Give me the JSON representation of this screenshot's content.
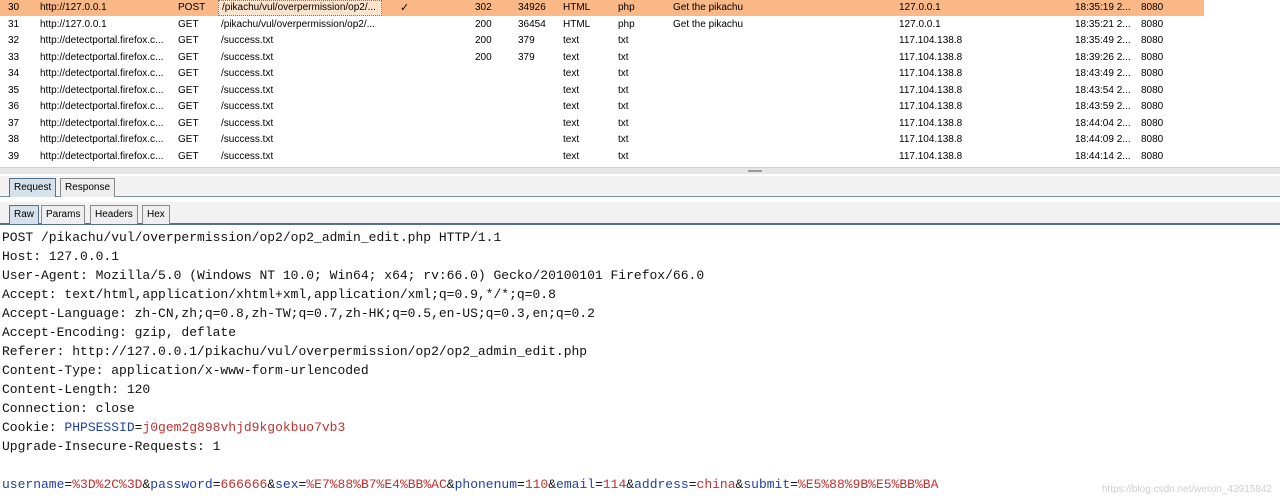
{
  "history": {
    "rows": [
      {
        "num": "30",
        "host": "http://127.0.0.1",
        "method": "POST",
        "url": "/pikachu/vul/overpermission/op2/...",
        "tick": "✓",
        "status": "302",
        "length": "34926",
        "mime": "HTML",
        "ext": "php",
        "title": "Get the pikachu",
        "ip": "127.0.0.1",
        "time": "18:35:19 2...",
        "port": "8080",
        "selected": true
      },
      {
        "num": "31",
        "host": "http://127.0.0.1",
        "method": "GET",
        "url": "/pikachu/vul/overpermission/op2/...",
        "tick": "",
        "status": "200",
        "length": "36454",
        "mime": "HTML",
        "ext": "php",
        "title": "Get the pikachu",
        "ip": "127.0.0.1",
        "time": "18:35:21 2...",
        "port": "8080"
      },
      {
        "num": "32",
        "host": "http://detectportal.firefox.c...",
        "method": "GET",
        "url": "/success.txt",
        "tick": "",
        "status": "200",
        "length": "379",
        "mime": "text",
        "ext": "txt",
        "title": "",
        "ip": "117.104.138.8",
        "time": "18:35:49 2...",
        "port": "8080"
      },
      {
        "num": "33",
        "host": "http://detectportal.firefox.c...",
        "method": "GET",
        "url": "/success.txt",
        "tick": "",
        "status": "200",
        "length": "379",
        "mime": "text",
        "ext": "txt",
        "title": "",
        "ip": "117.104.138.8",
        "time": "18:39:26 2...",
        "port": "8080"
      },
      {
        "num": "34",
        "host": "http://detectportal.firefox.c...",
        "method": "GET",
        "url": "/success.txt",
        "tick": "",
        "status": "",
        "length": "",
        "mime": "text",
        "ext": "txt",
        "title": "",
        "ip": "117.104.138.8",
        "time": "18:43:49 2...",
        "port": "8080"
      },
      {
        "num": "35",
        "host": "http://detectportal.firefox.c...",
        "method": "GET",
        "url": "/success.txt",
        "tick": "",
        "status": "",
        "length": "",
        "mime": "text",
        "ext": "txt",
        "title": "",
        "ip": "117.104.138.8",
        "time": "18:43:54 2...",
        "port": "8080"
      },
      {
        "num": "36",
        "host": "http://detectportal.firefox.c...",
        "method": "GET",
        "url": "/success.txt",
        "tick": "",
        "status": "",
        "length": "",
        "mime": "text",
        "ext": "txt",
        "title": "",
        "ip": "117.104.138.8",
        "time": "18:43:59 2...",
        "port": "8080"
      },
      {
        "num": "37",
        "host": "http://detectportal.firefox.c...",
        "method": "GET",
        "url": "/success.txt",
        "tick": "",
        "status": "",
        "length": "",
        "mime": "text",
        "ext": "txt",
        "title": "",
        "ip": "117.104.138.8",
        "time": "18:44:04 2...",
        "port": "8080"
      },
      {
        "num": "38",
        "host": "http://detectportal.firefox.c...",
        "method": "GET",
        "url": "/success.txt",
        "tick": "",
        "status": "",
        "length": "",
        "mime": "text",
        "ext": "txt",
        "title": "",
        "ip": "117.104.138.8",
        "time": "18:44:09 2...",
        "port": "8080"
      },
      {
        "num": "39",
        "host": "http://detectportal.firefox.c...",
        "method": "GET",
        "url": "/success.txt",
        "tick": "",
        "status": "",
        "length": "",
        "mime": "text",
        "ext": "txt",
        "title": "",
        "ip": "117.104.138.8",
        "time": "18:44:14 2...",
        "port": "8080"
      }
    ]
  },
  "message_tabs": {
    "request": "Request",
    "response": "Response",
    "active": "request"
  },
  "view_tabs": {
    "raw": "Raw",
    "params": "Params",
    "headers": "Headers",
    "hex": "Hex",
    "active": "raw"
  },
  "request": {
    "request_line": "POST /pikachu/vul/overpermission/op2/op2_admin_edit.php HTTP/1.1",
    "headers": [
      "Host: 127.0.0.1",
      "User-Agent: Mozilla/5.0 (Windows NT 10.0; Win64; x64; rv:66.0) Gecko/20100101 Firefox/66.0",
      "Accept: text/html,application/xhtml+xml,application/xml;q=0.9,*/*;q=0.8",
      "Accept-Language: zh-CN,zh;q=0.8,zh-TW;q=0.7,zh-HK;q=0.5,en-US;q=0.3,en;q=0.2",
      "Accept-Encoding: gzip, deflate",
      "Referer: http://127.0.0.1/pikachu/vul/overpermission/op2/op2_admin_edit.php",
      "Content-Type: application/x-www-form-urlencoded",
      "Content-Length: 120",
      "Connection: close"
    ],
    "cookie": {
      "label": "Cookie: ",
      "name": "PHPSESSID",
      "value": "j0gem2g898vhjd9kgokbuo7vb3"
    },
    "after_cookie": [
      "Upgrade-Insecure-Requests: 1"
    ],
    "body_params": [
      {
        "name": "username",
        "value": "%3D%2C%3D"
      },
      {
        "name": "password",
        "value": "666666"
      },
      {
        "name": "sex",
        "value": "%E7%88%B7%E4%BB%AC"
      },
      {
        "name": "phonenum",
        "value": "110"
      },
      {
        "name": "email",
        "value": "114"
      },
      {
        "name": "address",
        "value": "china"
      },
      {
        "name": "submit",
        "value": "%E5%88%9B%E5%BB%BA"
      }
    ]
  },
  "watermark": "https://blog.csdn.net/weixin_43915842",
  "colors": {
    "selected_row": "#f9b886",
    "param_name": "#1f3fa8",
    "param_value": "#c03030",
    "tab_active": "#d6e1ec"
  }
}
